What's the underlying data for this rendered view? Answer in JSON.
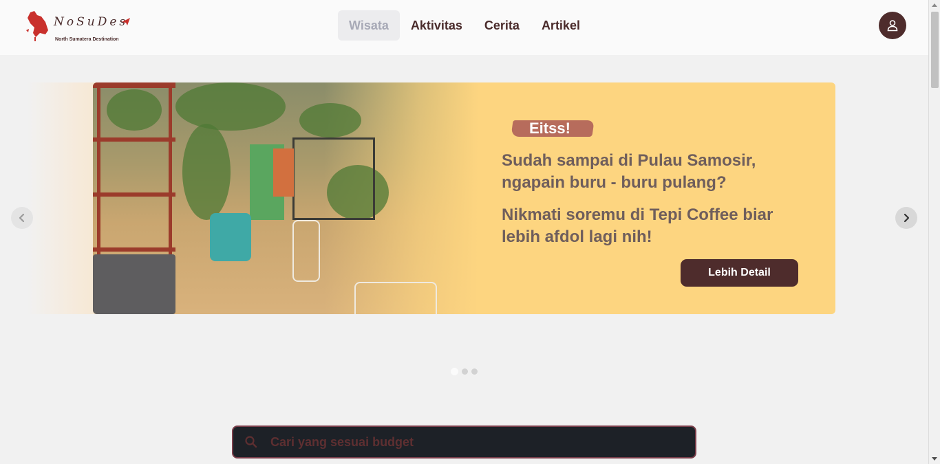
{
  "brand": {
    "wordmark": "NoSuDes",
    "tagline": "North Sumatera Destination"
  },
  "nav": {
    "items": [
      {
        "label": "Wisata",
        "active": true
      },
      {
        "label": "Aktivitas",
        "active": false
      },
      {
        "label": "Cerita",
        "active": false
      },
      {
        "label": "Artikel",
        "active": false
      }
    ]
  },
  "header": {
    "user_icon": "user-icon"
  },
  "carousel": {
    "badge": "Eitss!",
    "line1": "Sudah sampai di Pulau Samosir, ngapain buru - buru pulang?",
    "line2": "Nikmati soremu di Tepi Coffee biar lebih afdol lagi nih!",
    "cta_label": "Lebih Detail",
    "slide_count": 3,
    "active_slide": 1,
    "prev_icon": "chevron-left-icon",
    "next_icon": "chevron-right-icon"
  },
  "search": {
    "placeholder": "Cari yang sesuai budget",
    "icon": "search-icon"
  },
  "colors": {
    "brand_brown": "#4e2c2c",
    "slide_yellow": "#fdd580",
    "badge_terracotta": "#b76c5c",
    "search_bg": "#1d2127",
    "search_border": "#7a3e4a"
  }
}
